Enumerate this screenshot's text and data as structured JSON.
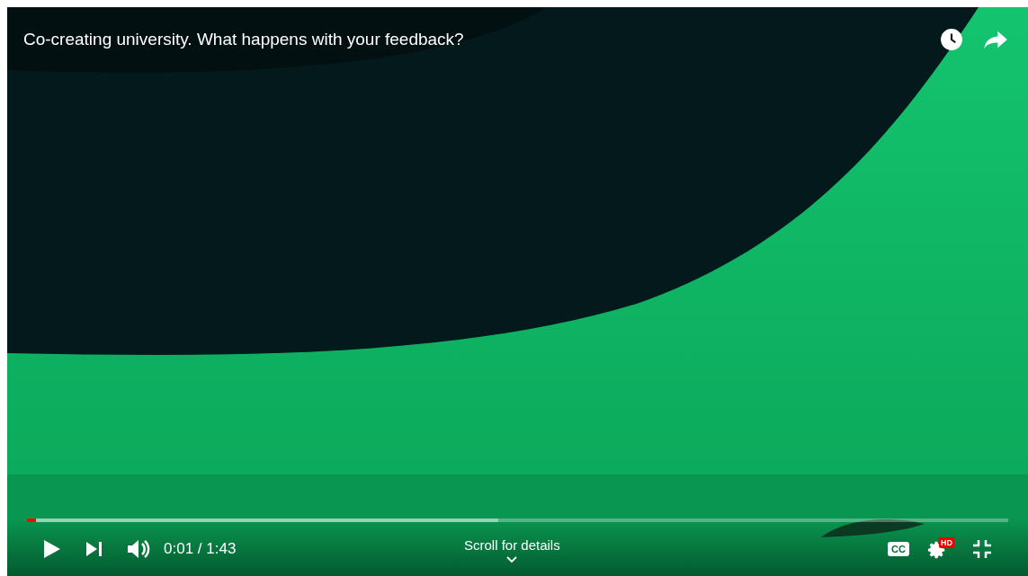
{
  "video": {
    "kind": "picture",
    "title": "Co-creating university. What happens with your feedback?"
  },
  "progress": {
    "level": 0.009
  },
  "controls": {
    "time": "0:01 / 1:43",
    "scroll_hint": "Scroll for details",
    "captions_label": "CC",
    "quality_badge": "HD"
  }
}
